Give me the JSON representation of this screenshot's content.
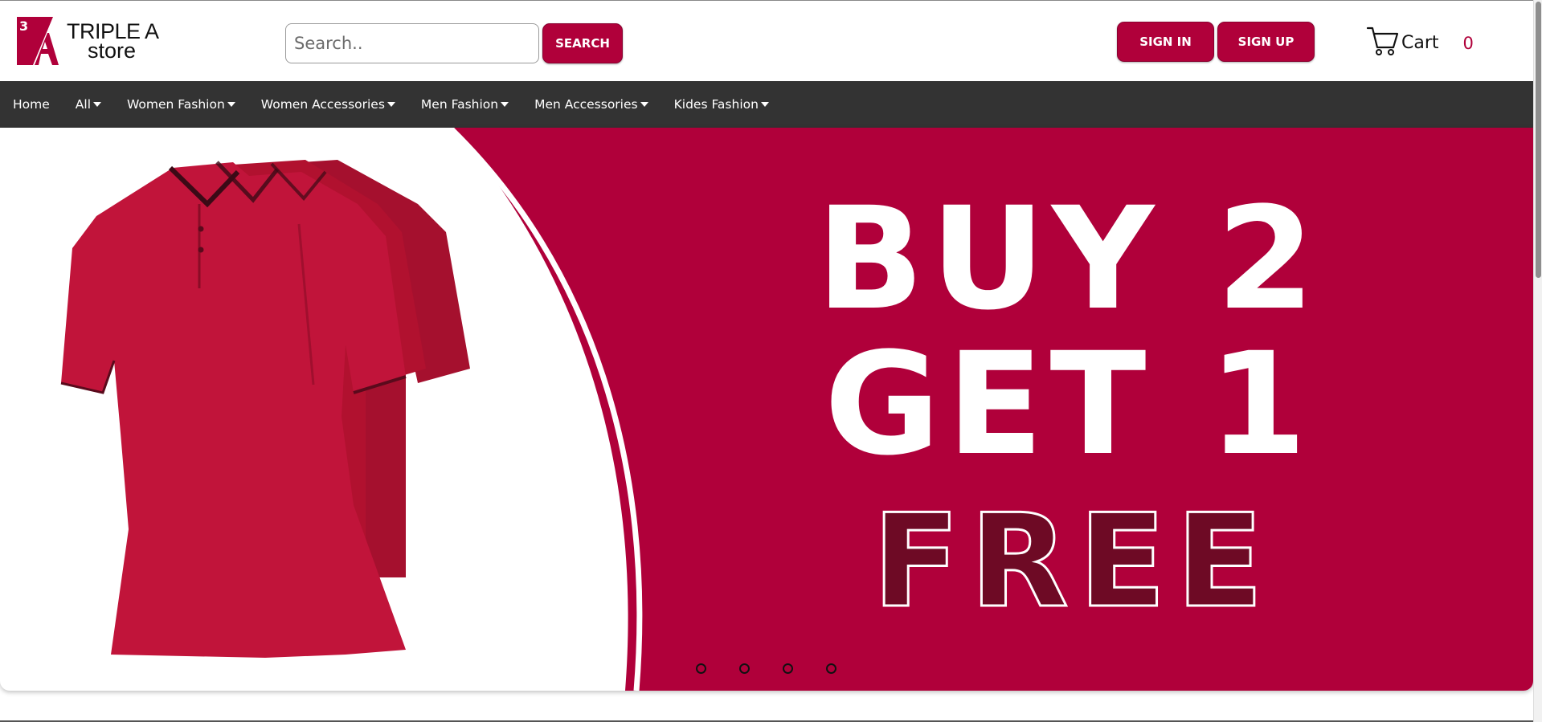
{
  "brand": {
    "line1": "TRIPLE A",
    "line2": "store",
    "mark_number": "3",
    "mark_letter": "A"
  },
  "search": {
    "placeholder": "Search..",
    "button_label": "SEARCH"
  },
  "auth": {
    "signin_label": "SIGN IN",
    "signup_label": "SIGN UP"
  },
  "cart": {
    "label": "Cart",
    "count": "0"
  },
  "nav": {
    "items": [
      {
        "label": "Home",
        "has_dropdown": false
      },
      {
        "label": "All",
        "has_dropdown": true
      },
      {
        "label": "Women Fashion",
        "has_dropdown": true
      },
      {
        "label": "Women Accessories",
        "has_dropdown": true
      },
      {
        "label": "Men Fashion",
        "has_dropdown": true
      },
      {
        "label": "Men Accessories",
        "has_dropdown": true
      },
      {
        "label": "Kides Fashion",
        "has_dropdown": true
      }
    ]
  },
  "hero": {
    "line1": "BUY 2",
    "line2": "GET 1",
    "line3": "FREE",
    "slide_count": 4
  },
  "colors": {
    "brand": "#b0003a",
    "nav_bg": "#333333",
    "free_text": "#6e0a25"
  }
}
